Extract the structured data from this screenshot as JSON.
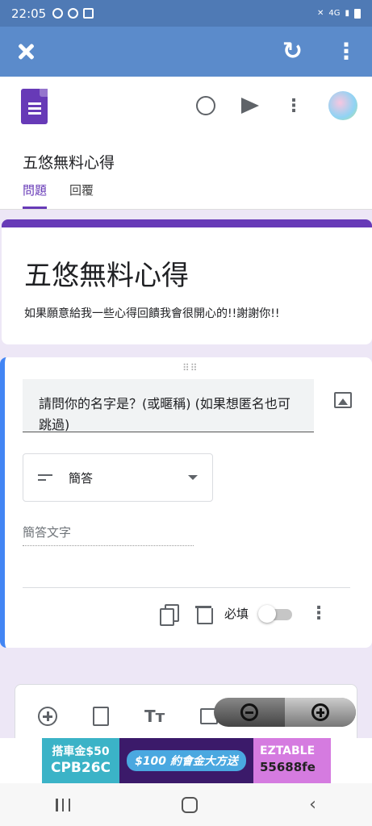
{
  "status_bar": {
    "time": "22:05",
    "signal_text": "4G"
  },
  "app_bar": {
    "close_label": "✕",
    "refresh_label": "↻",
    "more_label": "⋮"
  },
  "header": {
    "form_title": "五悠無料心得",
    "tabs": [
      {
        "label": "問題",
        "active": true
      },
      {
        "label": "回覆",
        "active": false
      }
    ],
    "more_label": "⋮"
  },
  "title_card": {
    "title": "五悠無料心得",
    "description": "如果願意給我一些心得回饋我會很開心的!!謝謝你!!"
  },
  "question": {
    "text": "請問你的名字是？(或暱稱) (如果想匿名也可跳過)",
    "type_label": "簡答",
    "answer_placeholder": "簡答文字",
    "required_label": "必填",
    "required_on": false,
    "more_label": "⋮"
  },
  "toolbar": {
    "text_label": "Tт"
  },
  "ad": {
    "left_line1": "搭車金$50",
    "left_code": "CPB26C",
    "middle_text": "$100 約會金大方送",
    "right_brand": "EZTABLE",
    "right_code": "55688fe"
  },
  "nav": {
    "back_label": "‹"
  },
  "colors": {
    "status": "#4f7ab5",
    "appbar": "#5b8bcb",
    "accent": "#673ab7",
    "question_border": "#4285f4"
  }
}
